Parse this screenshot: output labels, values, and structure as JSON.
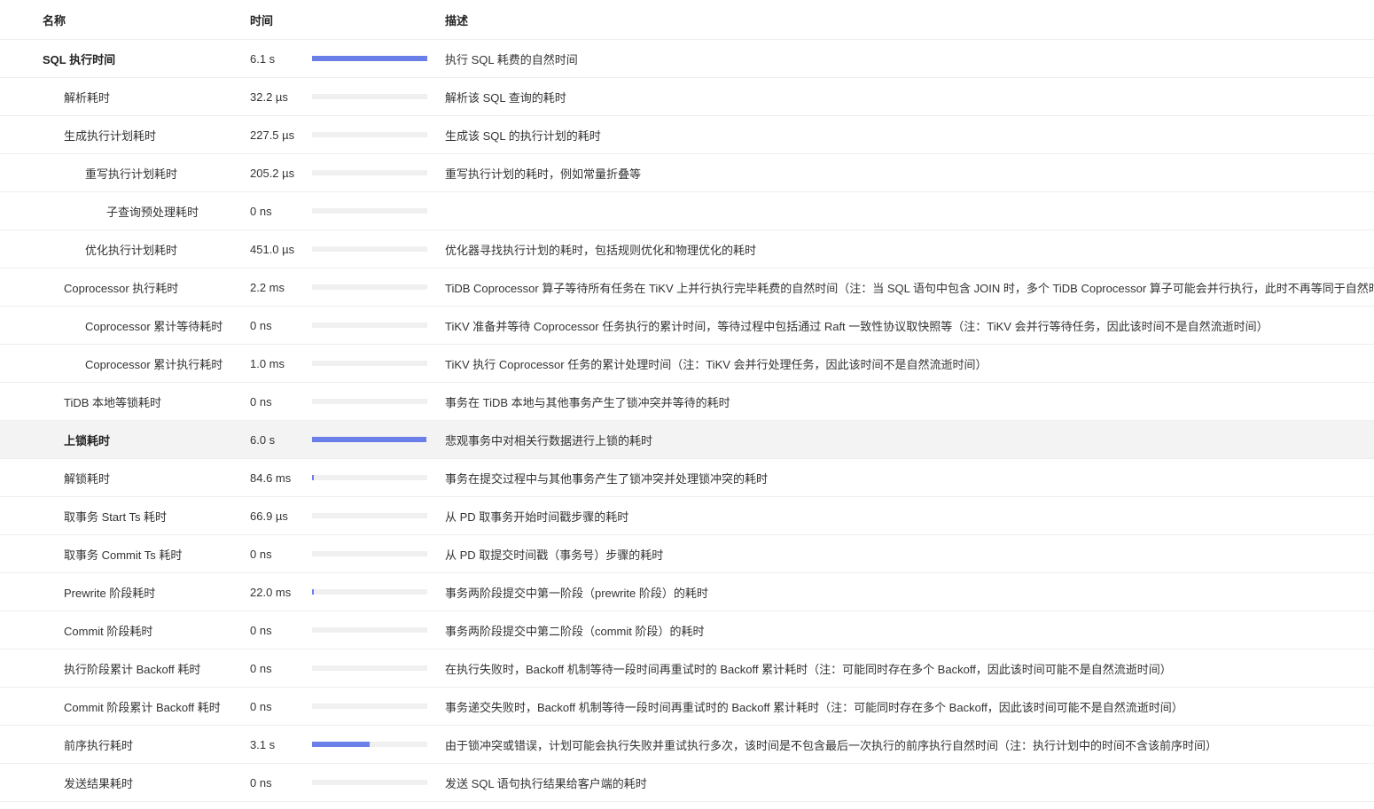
{
  "columns": {
    "name": "名称",
    "time": "时间",
    "desc": "描述"
  },
  "colors": {
    "bar": "#6b7fe8",
    "track": "#f0f0f0",
    "highlight": "#f3f3f3"
  },
  "rows": [
    {
      "name": "SQL 执行时间",
      "time": "6.1 s",
      "desc": "执行 SQL 耗费的自然时间",
      "level": 0,
      "bold": true,
      "fill": 1.0
    },
    {
      "name": "解析耗时",
      "time": "32.2 µs",
      "desc": "解析该 SQL 查询的耗时",
      "level": 1,
      "fill": 0
    },
    {
      "name": "生成执行计划耗时",
      "time": "227.5 µs",
      "desc": "生成该 SQL 的执行计划的耗时",
      "level": 1,
      "fill": 0
    },
    {
      "name": "重写执行计划耗时",
      "time": "205.2 µs",
      "desc": "重写执行计划的耗时，例如常量折叠等",
      "level": 2,
      "fill": 0
    },
    {
      "name": "子查询预处理耗时",
      "time": "0 ns",
      "desc": "",
      "level": 3,
      "fill": 0
    },
    {
      "name": "优化执行计划耗时",
      "time": "451.0 µs",
      "desc": "优化器寻找执行计划的耗时，包括规则优化和物理优化的耗时",
      "level": 2,
      "fill": 0
    },
    {
      "name": "Coprocessor 执行耗时",
      "time": "2.2 ms",
      "desc": "TiDB Coprocessor 算子等待所有任务在 TiKV 上并行执行完毕耗费的自然时间（注：当 SQL 语句中包含 JOIN 时，多个 TiDB Coprocessor 算子可能会并行执行，此时不再等同于自然时间）",
      "level": 1,
      "fill": 0
    },
    {
      "name": "Coprocessor 累计等待耗时",
      "time": "0 ns",
      "desc": "TiKV 准备并等待 Coprocessor 任务执行的累计时间，等待过程中包括通过 Raft 一致性协议取快照等（注：TiKV 会并行等待任务，因此该时间不是自然流逝时间）",
      "level": 2,
      "fill": 0
    },
    {
      "name": "Coprocessor 累计执行耗时",
      "time": "1.0 ms",
      "desc": "TiKV 执行 Coprocessor 任务的累计处理时间（注：TiKV 会并行处理任务，因此该时间不是自然流逝时间）",
      "level": 2,
      "fill": 0
    },
    {
      "name": "TiDB 本地等锁耗时",
      "time": "0 ns",
      "desc": "事务在 TiDB 本地与其他事务产生了锁冲突并等待的耗时",
      "level": 1,
      "fill": 0
    },
    {
      "name": "上锁耗时",
      "time": "6.0 s",
      "desc": "悲观事务中对相关行数据进行上锁的耗时",
      "level": 1,
      "bold": true,
      "highlighted": true,
      "fill": 0.99
    },
    {
      "name": "解锁耗时",
      "time": "84.6 ms",
      "desc": "事务在提交过程中与其他事务产生了锁冲突并处理锁冲突的耗时",
      "level": 1,
      "fill": 0.014
    },
    {
      "name": "取事务 Start Ts 耗时",
      "time": "66.9 µs",
      "desc": "从 PD 取事务开始时间戳步骤的耗时",
      "level": 1,
      "fill": 0
    },
    {
      "name": "取事务 Commit Ts 耗时",
      "time": "0 ns",
      "desc": "从 PD 取提交时间戳（事务号）步骤的耗时",
      "level": 1,
      "fill": 0
    },
    {
      "name": "Prewrite 阶段耗时",
      "time": "22.0 ms",
      "desc": "事务两阶段提交中第一阶段（prewrite 阶段）的耗时",
      "level": 1,
      "fill": 0.004
    },
    {
      "name": "Commit 阶段耗时",
      "time": "0 ns",
      "desc": "事务两阶段提交中第二阶段（commit 阶段）的耗时",
      "level": 1,
      "fill": 0
    },
    {
      "name": "执行阶段累计 Backoff 耗时",
      "time": "0 ns",
      "desc": "在执行失败时，Backoff 机制等待一段时间再重试时的 Backoff 累计耗时（注：可能同时存在多个 Backoff，因此该时间可能不是自然流逝时间）",
      "level": 1,
      "fill": 0
    },
    {
      "name": "Commit 阶段累计 Backoff 耗时",
      "time": "0 ns",
      "desc": "事务递交失败时，Backoff 机制等待一段时间再重试时的 Backoff 累计耗时（注：可能同时存在多个 Backoff，因此该时间可能不是自然流逝时间）",
      "level": 1,
      "fill": 0
    },
    {
      "name": "前序执行耗时",
      "time": "3.1 s",
      "desc": "由于锁冲突或错误，计划可能会执行失败并重试执行多次，该时间是不包含最后一次执行的前序执行自然时间（注：执行计划中的时间不含该前序时间）",
      "level": 1,
      "fill": 0.5
    },
    {
      "name": "发送结果耗时",
      "time": "0 ns",
      "desc": "发送 SQL 语句执行结果给客户端的耗时",
      "level": 1,
      "fill": 0
    }
  ]
}
